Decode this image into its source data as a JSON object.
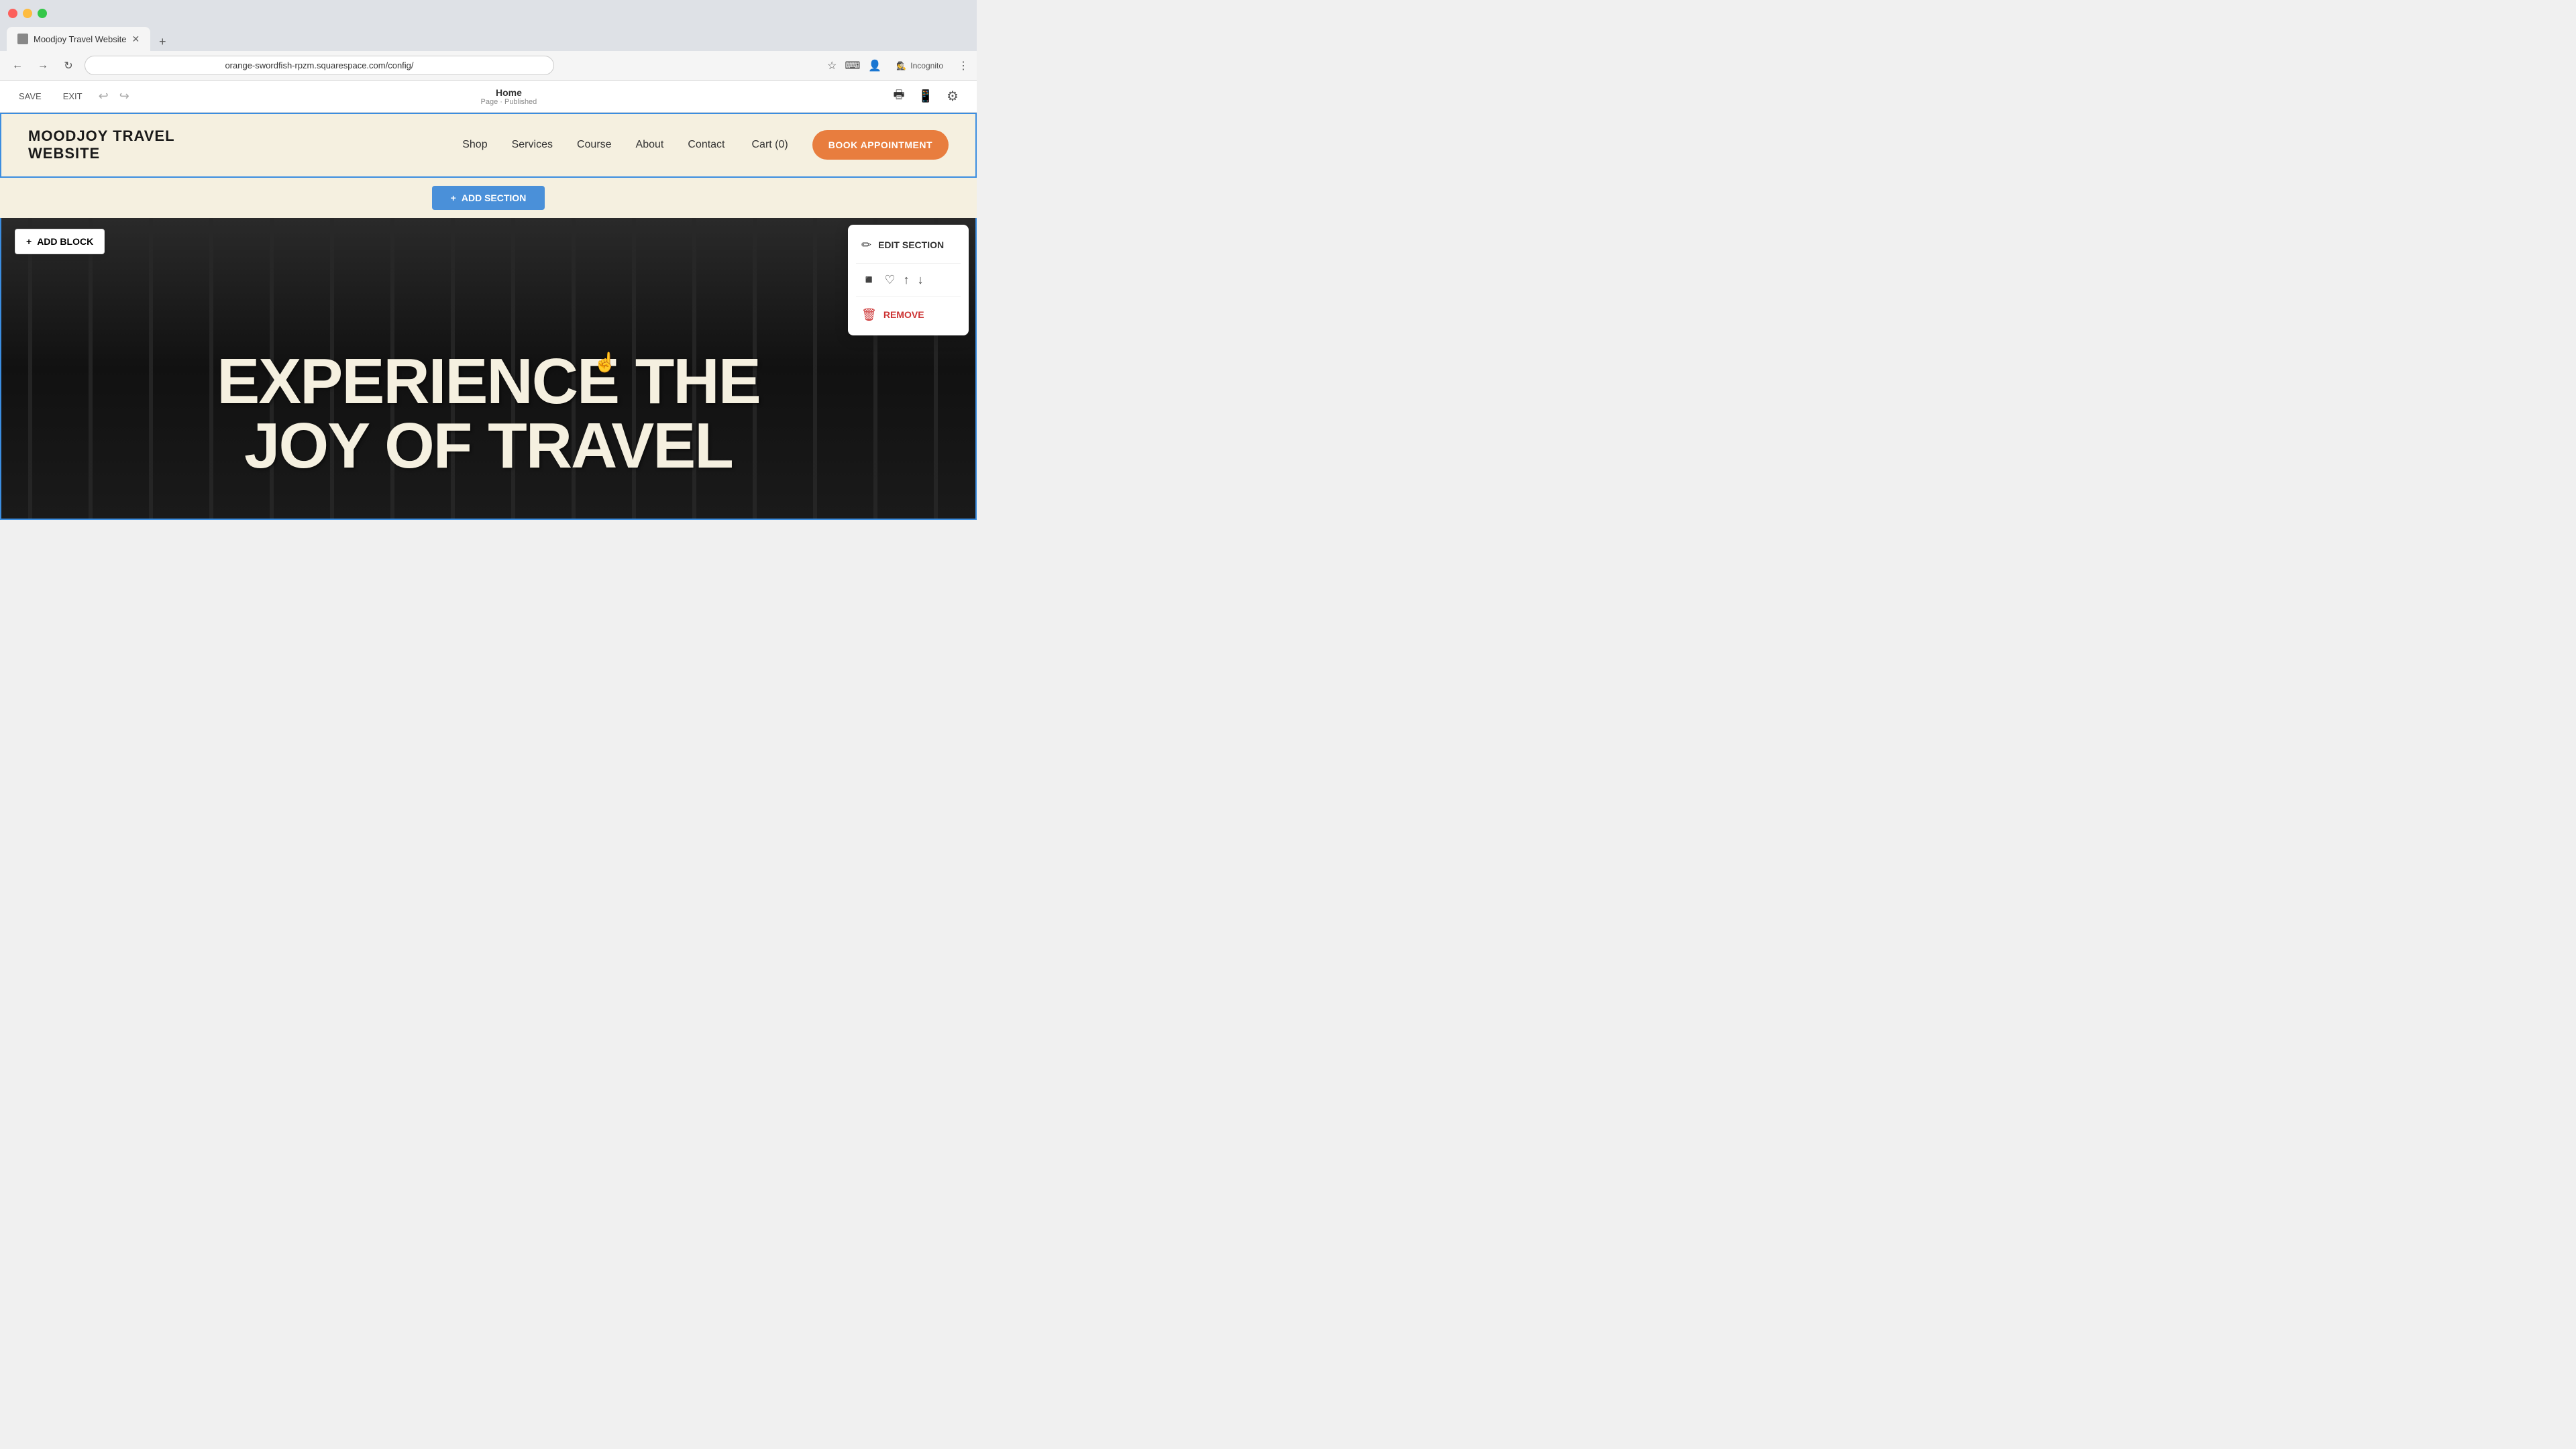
{
  "browser": {
    "tab_title": "Moodjoy Travel Website",
    "url": "orange-swordfish-rpzm.squarespace.com/config/",
    "new_tab_label": "+",
    "incognito_label": "Incognito"
  },
  "editor": {
    "save_label": "SAVE",
    "exit_label": "EXIT",
    "page_name": "Home",
    "page_status": "Page · Published"
  },
  "header": {
    "logo_text": "MOODJOY TRAVEL WEBSITE",
    "nav_links": [
      {
        "label": "Shop"
      },
      {
        "label": "Services"
      },
      {
        "label": "Course"
      },
      {
        "label": "About"
      },
      {
        "label": "Contact"
      }
    ],
    "cart_label": "Cart (0)",
    "book_btn_label": "BOOK APPOINTMENT"
  },
  "add_section": {
    "label": "ADD SECTION"
  },
  "add_block": {
    "label": "ADD BLOCK"
  },
  "hero": {
    "line1": "EXPERIENCE THE",
    "line2": "JOY OF TRAVEL"
  },
  "context_menu": {
    "edit_section_label": "EDIT SECTION",
    "remove_label": "REMOVE"
  }
}
